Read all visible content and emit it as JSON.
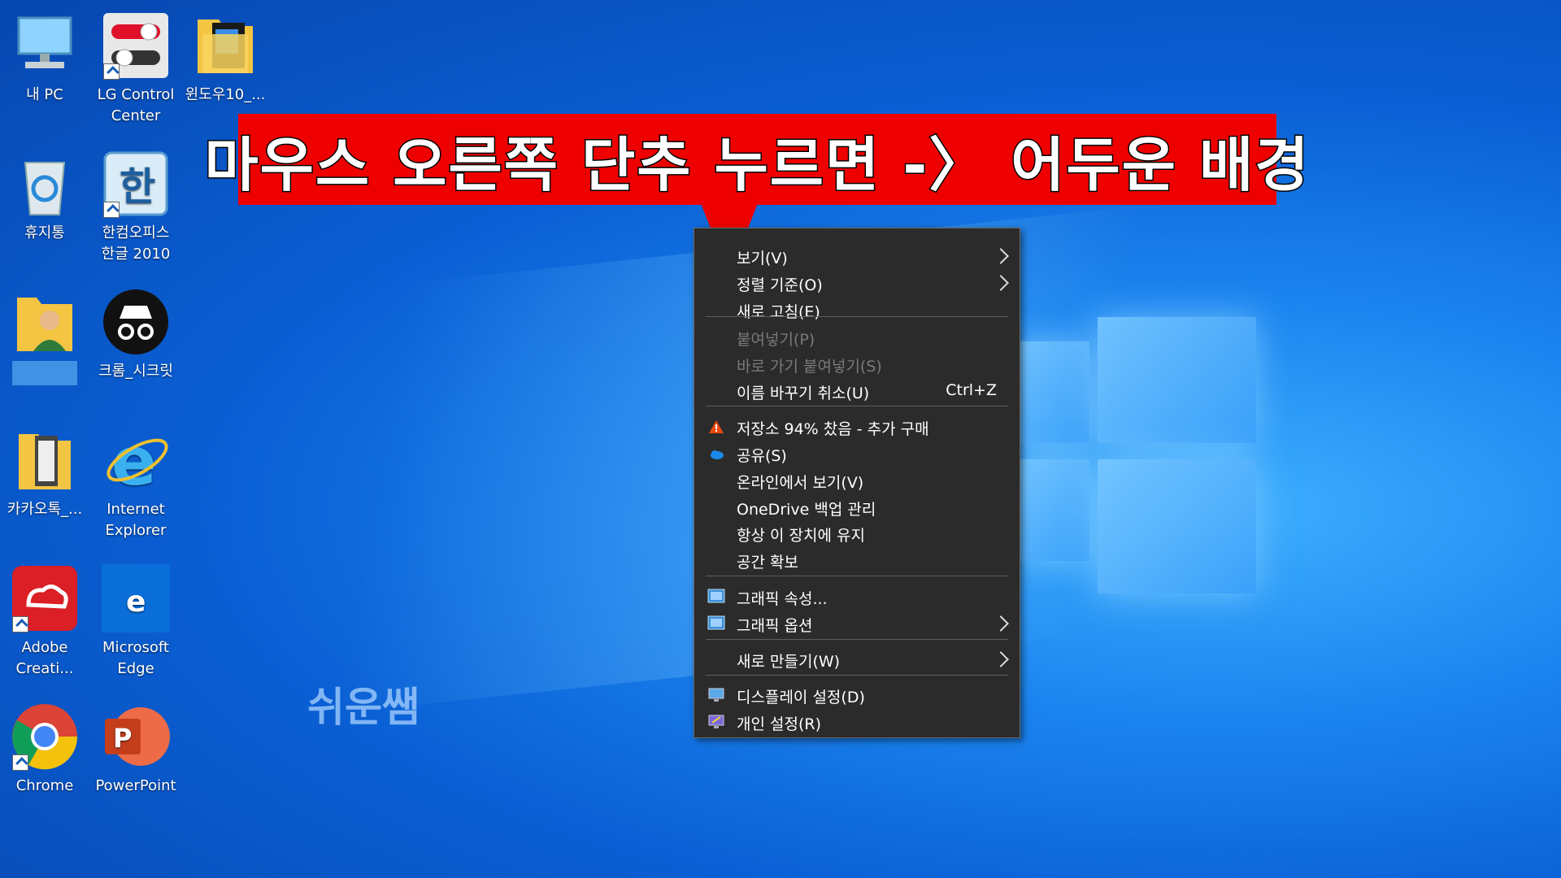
{
  "desktop_icons": [
    {
      "label": "내 PC",
      "icon": "computer-icon"
    },
    {
      "label": "LG Control\nCenter",
      "icon": "toggle-switch-icon"
    },
    {
      "label": "윈도우10_...",
      "icon": "folder-icon"
    },
    {
      "label": "휴지통",
      "icon": "recycle-bin-icon"
    },
    {
      "label": "한컴오피스\n한글 2010",
      "icon": "hangul-icon"
    },
    {
      "label": "",
      "icon": "user-folder-icon"
    },
    {
      "label": "크롬_시크릿",
      "icon": "incognito-icon"
    },
    {
      "label": "카카오톡_...",
      "icon": "folder-icon"
    },
    {
      "label": "Internet\nExplorer",
      "icon": "ie-icon"
    },
    {
      "label": "Adobe\nCreati...",
      "icon": "adobe-cc-icon"
    },
    {
      "label": "Microsoft\nEdge",
      "icon": "edge-icon"
    },
    {
      "label": "Chrome",
      "icon": "chrome-icon"
    },
    {
      "label": "PowerPoint",
      "icon": "powerpoint-icon"
    }
  ],
  "banner": {
    "text": "마우스 오른쪽 단추 누르면 -〉 어두운 배경"
  },
  "watermark": "쉬운쌤",
  "context_menu": {
    "items": [
      {
        "label": "보기(V)",
        "submenu": true
      },
      {
        "label": "정렬 기준(O)",
        "submenu": true
      },
      {
        "label": "새로 고침(E)"
      },
      {
        "label": "붙여넣기(P)",
        "disabled": true
      },
      {
        "label": "바로 가기 붙여넣기(S)",
        "disabled": true
      },
      {
        "label": "이름 바꾸기 취소(U)",
        "shortcut": "Ctrl+Z"
      },
      {
        "label": "저장소 94% 찼음 - 추가 구매",
        "icon": "warning-icon"
      },
      {
        "label": "공유(S)",
        "icon": "onedrive-cloud-icon"
      },
      {
        "label": "온라인에서 보기(V)"
      },
      {
        "label": "OneDrive 백업 관리"
      },
      {
        "label": "항상 이 장치에 유지"
      },
      {
        "label": "공간 확보"
      },
      {
        "label": "그래픽 속성...",
        "icon": "intel-graphics-icon"
      },
      {
        "label": "그래픽 옵션",
        "icon": "intel-graphics-icon",
        "submenu": true
      },
      {
        "label": "새로 만들기(W)",
        "submenu": true
      },
      {
        "label": "디스플레이 설정(D)",
        "icon": "display-icon"
      },
      {
        "label": "개인 설정(R)",
        "icon": "personalize-icon"
      }
    ]
  }
}
